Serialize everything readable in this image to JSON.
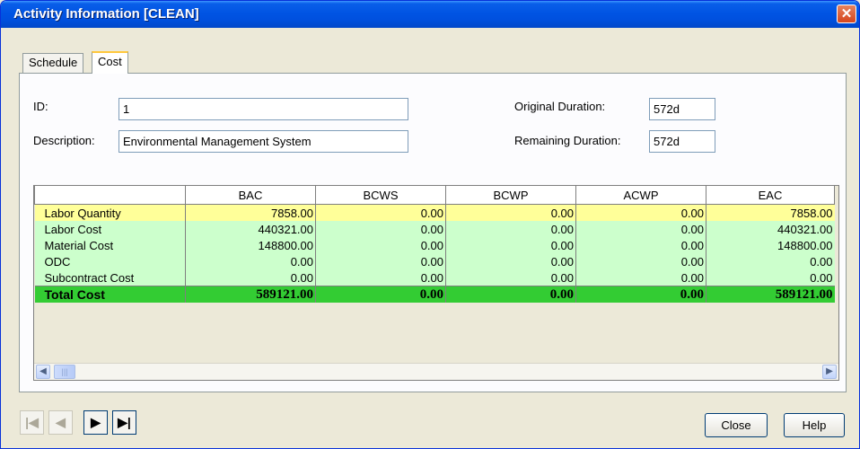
{
  "window": {
    "title": "Activity Information [CLEAN]",
    "close_symbol": "✕"
  },
  "tabs": [
    {
      "label": "Schedule",
      "active": false
    },
    {
      "label": "Cost",
      "active": true
    }
  ],
  "form": {
    "id_label": "ID:",
    "id_value": "1",
    "description_label": "Description:",
    "description_value": "Environmental Management System",
    "original_duration_label": "Original Duration:",
    "original_duration_value": "572d",
    "remaining_duration_label": "Remaining Duration:",
    "remaining_duration_value": "572d"
  },
  "table": {
    "columns": [
      "",
      "BAC",
      "BCWS",
      "BCWP",
      "ACWP",
      "EAC"
    ],
    "rows": [
      {
        "label": "Labor Quantity",
        "values": [
          "7858.00",
          "0.00",
          "0.00",
          "0.00",
          "7858.00"
        ],
        "style": "yellow"
      },
      {
        "label": "Labor Cost",
        "values": [
          "440321.00",
          "0.00",
          "0.00",
          "0.00",
          "440321.00"
        ],
        "style": "green"
      },
      {
        "label": "Material Cost",
        "values": [
          "148800.00",
          "0.00",
          "0.00",
          "0.00",
          "148800.00"
        ],
        "style": "green"
      },
      {
        "label": "ODC",
        "values": [
          "0.00",
          "0.00",
          "0.00",
          "0.00",
          "0.00"
        ],
        "style": "green"
      },
      {
        "label": "Subcontract Cost",
        "values": [
          "0.00",
          "0.00",
          "0.00",
          "0.00",
          "0.00"
        ],
        "style": "green"
      },
      {
        "label": "Total Cost",
        "values": [
          "589121.00",
          "0.00",
          "0.00",
          "0.00",
          "589121.00"
        ],
        "style": "total"
      }
    ],
    "colors": {
      "yellow": "#ffff99",
      "green": "#ccffcc",
      "total": "#33cc33"
    }
  },
  "navigation": {
    "first_icon": "first-record-icon",
    "prev_icon": "previous-record-icon",
    "next_icon": "next-record-icon",
    "last_icon": "last-record-icon"
  },
  "buttons": {
    "close_label": "Close",
    "help_label": "Help"
  }
}
